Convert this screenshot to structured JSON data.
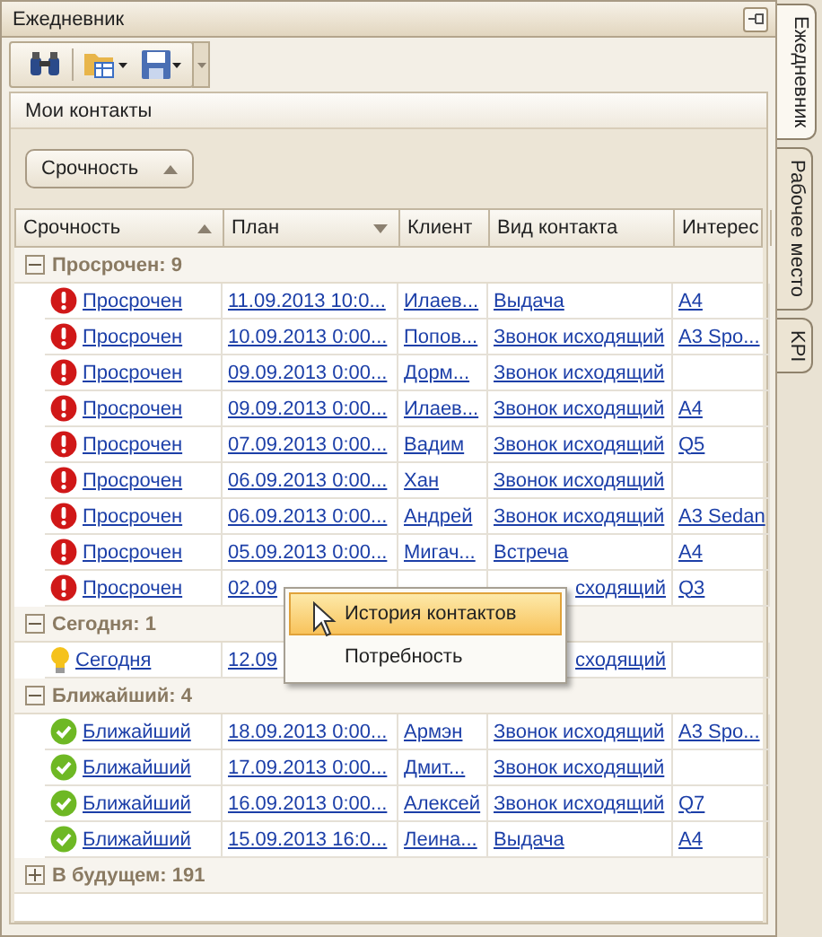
{
  "window": {
    "title": "Ежедневник"
  },
  "side_tabs": [
    {
      "label": "Ежедневник",
      "selected": true
    },
    {
      "label": "Рабочее место",
      "selected": false
    },
    {
      "label": "KPI",
      "selected": false
    }
  ],
  "panel_tab": "Мои контакты",
  "group_by": {
    "label": "Срочность",
    "sort_ascending": true
  },
  "columns": [
    {
      "label": "Срочность",
      "sort_ascending": true
    },
    {
      "label": "План",
      "sort_ascending": false
    },
    {
      "label": "Клиент"
    },
    {
      "label": "Вид контакта"
    },
    {
      "label": "Интерес"
    }
  ],
  "groups": [
    {
      "label": "Просрочен: 9",
      "expanded": true,
      "rows": [
        {
          "kind": "overdue",
          "urgency": "Просрочен",
          "plan": "11.09.2013 10:0...",
          "client": "Илаев...",
          "contact": "Выдача",
          "interest": "A4"
        },
        {
          "kind": "overdue",
          "urgency": "Просрочен",
          "plan": "10.09.2013 0:00...",
          "client": "Попов...",
          "contact": "Звонок исходящий",
          "interest": "A3 Spo..."
        },
        {
          "kind": "overdue",
          "urgency": "Просрочен",
          "plan": "09.09.2013 0:00...",
          "client": "Дорм...",
          "contact": "Звонок исходящий",
          "interest": ""
        },
        {
          "kind": "overdue",
          "urgency": "Просрочен",
          "plan": "09.09.2013 0:00...",
          "client": "Илаев...",
          "contact": "Звонок исходящий",
          "interest": "A4"
        },
        {
          "kind": "overdue",
          "urgency": "Просрочен",
          "plan": "07.09.2013 0:00...",
          "client": "Вадим",
          "contact": "Звонок исходящий",
          "interest": "Q5"
        },
        {
          "kind": "overdue",
          "urgency": "Просрочен",
          "plan": "06.09.2013 0:00...",
          "client": "Хан",
          "contact": "Звонок исходящий",
          "interest": ""
        },
        {
          "kind": "overdue",
          "urgency": "Просрочен",
          "plan": "06.09.2013 0:00...",
          "client": "Андрей",
          "contact": "Звонок исходящий",
          "interest": "A3 Sedan"
        },
        {
          "kind": "overdue",
          "urgency": "Просрочен",
          "plan": "05.09.2013 0:00...",
          "client": "Мигач...",
          "contact": "Встреча",
          "interest": "A4"
        },
        {
          "kind": "overdue",
          "urgency": "Просрочен",
          "plan": "02.09",
          "client": "",
          "contact": "сходящий",
          "interest": "Q3",
          "covered": true
        }
      ]
    },
    {
      "label": "Сегодня: 1",
      "expanded": true,
      "rows": [
        {
          "kind": "today",
          "urgency": "Сегодня",
          "plan": "12.09",
          "client": "",
          "contact": "сходящий",
          "interest": "",
          "covered": true
        }
      ]
    },
    {
      "label": "Ближайший: 4",
      "expanded": true,
      "rows": [
        {
          "kind": "soon",
          "urgency": "Ближайший",
          "plan": "18.09.2013 0:00...",
          "client": "Армэн",
          "contact": "Звонок исходящий",
          "interest": "A3 Spo..."
        },
        {
          "kind": "soon",
          "urgency": "Ближайший",
          "plan": "17.09.2013 0:00...",
          "client": "Дмит...",
          "contact": "Звонок исходящий",
          "interest": ""
        },
        {
          "kind": "soon",
          "urgency": "Ближайший",
          "plan": "16.09.2013 0:00...",
          "client": "Алексей",
          "contact": "Звонок исходящий",
          "interest": "Q7"
        },
        {
          "kind": "soon",
          "urgency": "Ближайший",
          "plan": "15.09.2013 16:0...",
          "client": "Леина...",
          "contact": "Выдача",
          "interest": "A4"
        }
      ]
    },
    {
      "label": "В будущем: 191",
      "expanded": false
    }
  ],
  "context_menu": [
    {
      "label": "История контактов",
      "selected": true
    },
    {
      "label": "Потребность",
      "selected": false
    }
  ]
}
